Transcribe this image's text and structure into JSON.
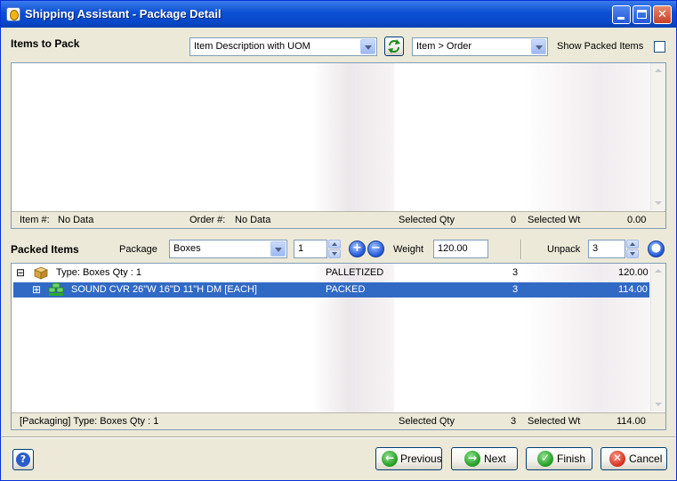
{
  "window": {
    "title": "Shipping Assistant - Package Detail"
  },
  "items_to_pack": {
    "heading": "Items to Pack",
    "view_combo": "Item Description with UOM",
    "sort_combo": "Item > Order",
    "show_packed_label": "Show Packed Items",
    "show_packed_checked": false,
    "status": {
      "item_label": "Item #:",
      "item_value": "No Data",
      "order_label": "Order #:",
      "order_value": "No Data",
      "sel_qty_label": "Selected Qty",
      "sel_qty_value": "0",
      "sel_wt_label": "Selected Wt",
      "sel_wt_value": "0.00"
    }
  },
  "packed_items": {
    "heading": "Packed Items",
    "package_label": "Package",
    "package_value": "Boxes",
    "package_qty": "1",
    "weight_label": "Weight",
    "weight_value": "120.00",
    "unpack_label": "Unpack",
    "unpack_value": "3",
    "rows": [
      {
        "expander": "⊟",
        "text": "Type:  Boxes  Qty : 1",
        "status": "PALLETIZED",
        "qty": "3",
        "weight": "120.00",
        "icon": "box-icon",
        "selected": false
      },
      {
        "expander": "⊞",
        "text": "SOUND CVR 26\"W 16\"D 11\"H DM [EACH]",
        "status": "PACKED",
        "qty": "3",
        "weight": "114.00",
        "icon": "pallet-item-icon",
        "selected": true
      }
    ],
    "status": {
      "packaging_text": "[Packaging] Type:  Boxes  Qty : 1",
      "sel_qty_label": "Selected Qty",
      "sel_qty_value": "3",
      "sel_wt_label": "Selected Wt",
      "sel_wt_value": "114.00"
    }
  },
  "footer": {
    "previous": "Previous",
    "next": "Next",
    "finish": "Finish",
    "cancel": "Cancel"
  },
  "colors": {
    "title_bar": "#0a4fd4",
    "selection": "#316ac5",
    "face": "#ece9d8"
  }
}
